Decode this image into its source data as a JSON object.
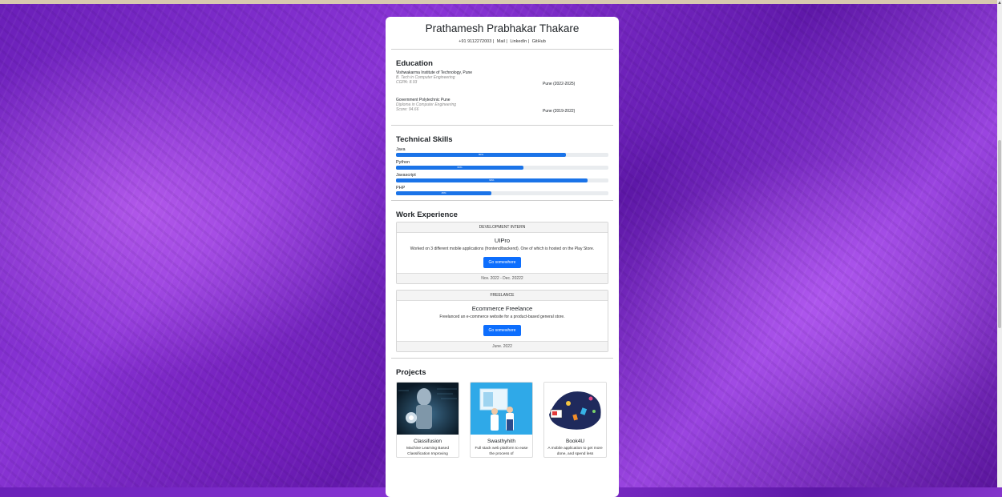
{
  "header": {
    "name": "Prathamesh Prabhakar Thakare",
    "phone": "+91 9112272003 |",
    "mail": "Mail |",
    "linkedin": "LinkedIn |",
    "github": "GitHub"
  },
  "education": {
    "title": "Education",
    "items": [
      {
        "institution": "Vishwakarma Institute of Technology, Pune",
        "degree": "B. Tech in Computer Engineering",
        "score": "CGPA: 8.93",
        "place": "Pune (2022-2025)"
      },
      {
        "institution": "Government Polytechnic Pune",
        "degree": "Diploma in Computer Engineering",
        "score": "Score: 94.66",
        "place": "Pune (2019-2022)"
      }
    ]
  },
  "skills": {
    "title": "Technical Skills",
    "items": [
      {
        "name": "Java",
        "percent": 80,
        "label": "80%"
      },
      {
        "name": "Python",
        "percent": 60,
        "label": "60%"
      },
      {
        "name": "Javascript",
        "percent": 90,
        "label": "90%"
      },
      {
        "name": "PHP",
        "percent": 45,
        "label": "45%"
      }
    ]
  },
  "experience": {
    "title": "Work Experience",
    "items": [
      {
        "header": "DEVELOPMENT INTERN",
        "title": "UIPro",
        "desc": "Worked on 3 different mobile applications (frontend/backend). One of which is hosted on the Play Store.",
        "button": "Go somewhere",
        "footer": "Nov. 2022 - Dec. 20222"
      },
      {
        "header": "FREELANCE",
        "title": "Ecommerce Freelance",
        "desc": "Freelanced an e-commerce website for a product-based general store.",
        "button": "Go somewhere",
        "footer": "June. 2022"
      }
    ]
  },
  "projects": {
    "title": "Projects",
    "items": [
      {
        "title": "Classifusion",
        "desc": "Machine Learning Based Classification Improving",
        "image_icon": "robot-hand-image"
      },
      {
        "title": "Swasthyhith",
        "desc": "Full stack web platform to ease the process of",
        "image_icon": "doctors-image"
      },
      {
        "title": "Book4U",
        "desc": "A mobile application to get more done, and spend less",
        "image_icon": "book-app-image"
      }
    ]
  }
}
